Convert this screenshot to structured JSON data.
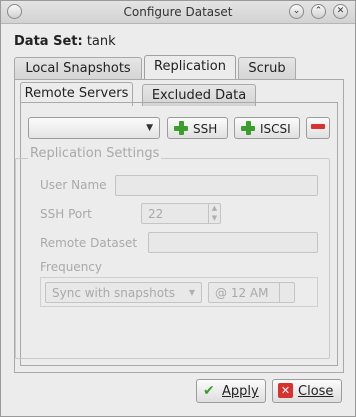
{
  "window": {
    "title": "Configure Dataset",
    "controls": {
      "minimize": "⌄",
      "maximize": "⌃",
      "close": "✕"
    }
  },
  "dataset": {
    "label": "Data Set:",
    "value": "tank"
  },
  "tabs": [
    {
      "label": "Local Snapshots",
      "active": false
    },
    {
      "label": "Replication",
      "active": true
    },
    {
      "label": "Scrub",
      "active": false
    }
  ],
  "subtabs": [
    {
      "label": "Remote Servers",
      "active": true
    },
    {
      "label": "Excluded Data",
      "active": false
    }
  ],
  "servers": {
    "selected": "",
    "ssh_label": "SSH",
    "iscsi_label": "ISCSI"
  },
  "replication": {
    "title": "Replication Settings",
    "user_name_label": "User Name",
    "user_name_value": "",
    "ssh_port_label": "SSH Port",
    "ssh_port_value": "22",
    "remote_dataset_label": "Remote Dataset",
    "remote_dataset_value": "",
    "frequency_label": "Frequency",
    "frequency_value": "Sync with snapshots",
    "time_value": "@ 12 AM"
  },
  "footer": {
    "apply_label": "Apply",
    "close_label": "Close"
  },
  "colors": {
    "add_icon": "#3b9d2c",
    "remove_icon": "#d8322e",
    "disabled_text": "#a9a9a9"
  }
}
